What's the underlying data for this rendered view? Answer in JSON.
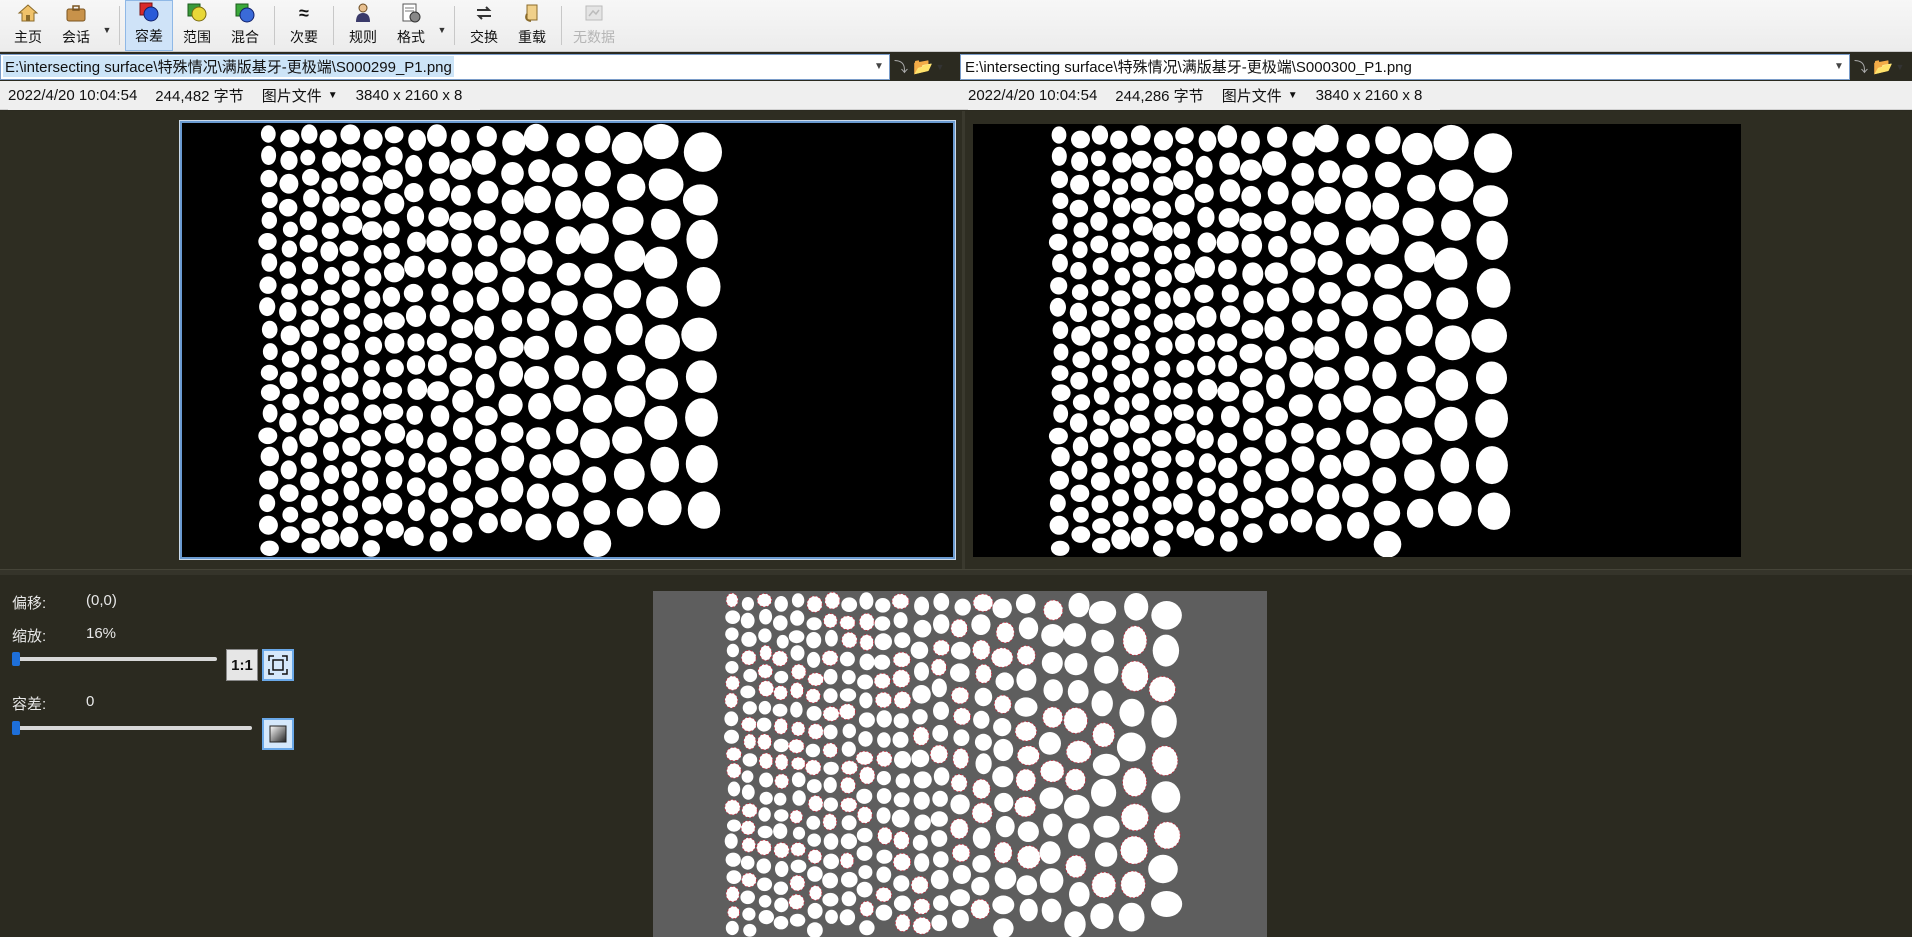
{
  "toolbar": {
    "home": "主页",
    "session": "会话",
    "tolerance": "容差",
    "range": "范围",
    "blend": "混合",
    "minor": "次要",
    "rules": "规则",
    "format": "格式",
    "swap": "交换",
    "reload": "重载",
    "nodata": "无数据"
  },
  "left": {
    "path": "E:\\intersecting surface\\特殊情况\\满版基牙-更极端\\S000299_P1.png",
    "date": "2022/4/20 10:04:54",
    "size": "244,482 字节",
    "type": "图片文件",
    "dims": "3840 x 2160 x 8"
  },
  "right": {
    "path": "E:\\intersecting surface\\特殊情况\\满版基牙-更极端\\S000300_P1.png",
    "date": "2022/4/20 10:04:54",
    "size": "244,286 字节",
    "type": "图片文件",
    "dims": "3840 x 2160 x 8"
  },
  "controls": {
    "offset_label": "偏移:",
    "offset_value": "(0,0)",
    "zoom_label": "缩放:",
    "zoom_value": "16%",
    "zoom_level": 0.16,
    "one_to_one": "1:1",
    "tolerance_label": "容差:",
    "tolerance_value": "0",
    "tolerance_level": 0
  },
  "colors": {
    "accent": "#1e6fd9",
    "panel_bg": "#2b2a20",
    "overlay_bg": "#5e5e5e",
    "diff_outline": "#c0283a"
  },
  "icons": {
    "home": "home-icon",
    "session": "briefcase-icon",
    "tolerance": "tolerance-icon",
    "range": "range-icon",
    "blend": "blend-icon",
    "minor": "approx-icon",
    "rules": "rules-icon",
    "format": "format-icon",
    "swap": "swap-icon",
    "reload": "reload-icon",
    "nodata": "nodata-icon"
  }
}
